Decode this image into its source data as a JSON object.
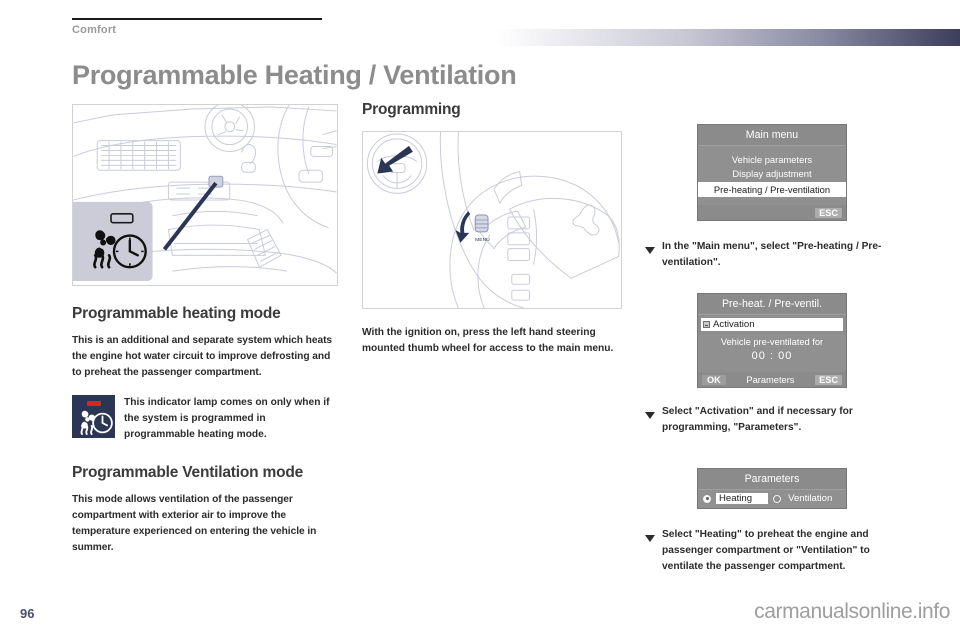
{
  "header": {
    "section": "Comfort",
    "title": "Programmable Heating / Ventilation"
  },
  "column_left": {
    "figure_caption_icon": "dashboard-preheating-indicator",
    "heading_1": "Programmable heating mode",
    "paragraph_1": "This is an additional and separate system which heats the engine hot water circuit to improve defrosting and to preheat the passenger compartment.",
    "indicator_note": "This indicator lamp comes on only when if the system is programmed in programmable heating mode.",
    "heading_2": "Programmable Ventilation mode",
    "paragraph_2": "This mode allows ventilation of the passenger compartment with exterior air to improve the temperature experienced on entering the vehicle in summer."
  },
  "column_middle": {
    "heading": "Programming",
    "caption": "With the ignition on, press the left hand steering mounted thumb wheel for access to the main menu."
  },
  "screens": {
    "main_menu": {
      "title": "Main menu",
      "items": [
        {
          "label": "Vehicle parameters",
          "selected": false
        },
        {
          "label": "Display adjustment",
          "selected": false
        },
        {
          "label": "Pre-heating / Pre-ventilation",
          "selected": true
        }
      ],
      "esc_label": "ESC"
    },
    "preheat": {
      "title": "Pre-heat. / Pre-ventil.",
      "activation_label": "Activation",
      "status_line": "Vehicle pre-ventilated for",
      "time_value": "00 : 00",
      "ok_label": "OK",
      "parameters_label": "Parameters",
      "esc_label": "ESC"
    },
    "parameters": {
      "title": "Parameters",
      "options": [
        {
          "label": "Heating",
          "selected": true
        },
        {
          "label": "Ventilation",
          "selected": false
        }
      ]
    }
  },
  "instructions": [
    "In the \"Main menu\", select \"Pre-heating / Pre-ventilation\".",
    "Select \"Activation\" and if necessary for programming, \"Parameters\".",
    "Select \"Heating\" to preheat the engine and passenger compartment or \"Ventilation\" to ventilate the passenger compartment."
  ],
  "footer": {
    "page_number": "96",
    "watermark": "carmanualsonline.info"
  },
  "colors": {
    "title_grey": "#8c8c8c",
    "section_grey": "#9a9a9a",
    "indicator_navy": "#2b3655",
    "indicator_red": "#e2231a",
    "screen_grey": "#909090",
    "gradient_end": "#3d3d5c",
    "page_number": "#4c4c6e"
  }
}
